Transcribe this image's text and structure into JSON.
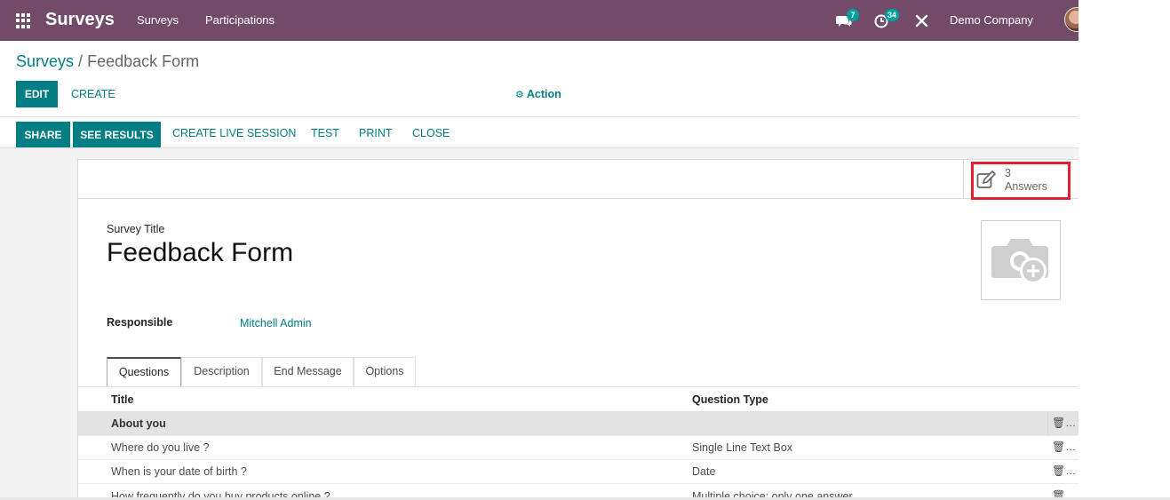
{
  "navbar": {
    "app_name": "Surveys",
    "menu": [
      "Surveys",
      "Participations"
    ],
    "messages_count": "7",
    "activities_count": "34",
    "company": "Demo Company",
    "color": "#714b67"
  },
  "breadcrumb": {
    "parent": "Surveys",
    "separator": "/",
    "current": "Feedback Form"
  },
  "control_panel": {
    "edit_label": "EDIT",
    "create_label": "CREATE",
    "action_label": "Action"
  },
  "statusbar": {
    "share": "SHARE",
    "see_results": "SEE RESULTS",
    "create_live_session": "CREATE LIVE SESSION",
    "test": "TEST",
    "print": "PRINT",
    "close": "CLOSE"
  },
  "stat_button": {
    "value": "3",
    "label": "Answers"
  },
  "form": {
    "title_label": "Survey Title",
    "title": "Feedback Form",
    "responsible_label": "Responsible",
    "responsible_value": "Mitchell Admin"
  },
  "tabs": [
    "Questions",
    "Description",
    "End Message",
    "Options"
  ],
  "table": {
    "columns": [
      "Title",
      "Question Type"
    ],
    "rows": [
      {
        "title": "About you",
        "type": "",
        "section": true
      },
      {
        "title": "Where do you live ?",
        "type": "Single Line Text Box",
        "section": false
      },
      {
        "title": "When is your date of birth ?",
        "type": "Date",
        "section": false
      },
      {
        "title": "How frequently do you buy products online ?",
        "type": "Multiple choice: only one answer",
        "section": false
      }
    ]
  },
  "accent_color": "#017e84"
}
